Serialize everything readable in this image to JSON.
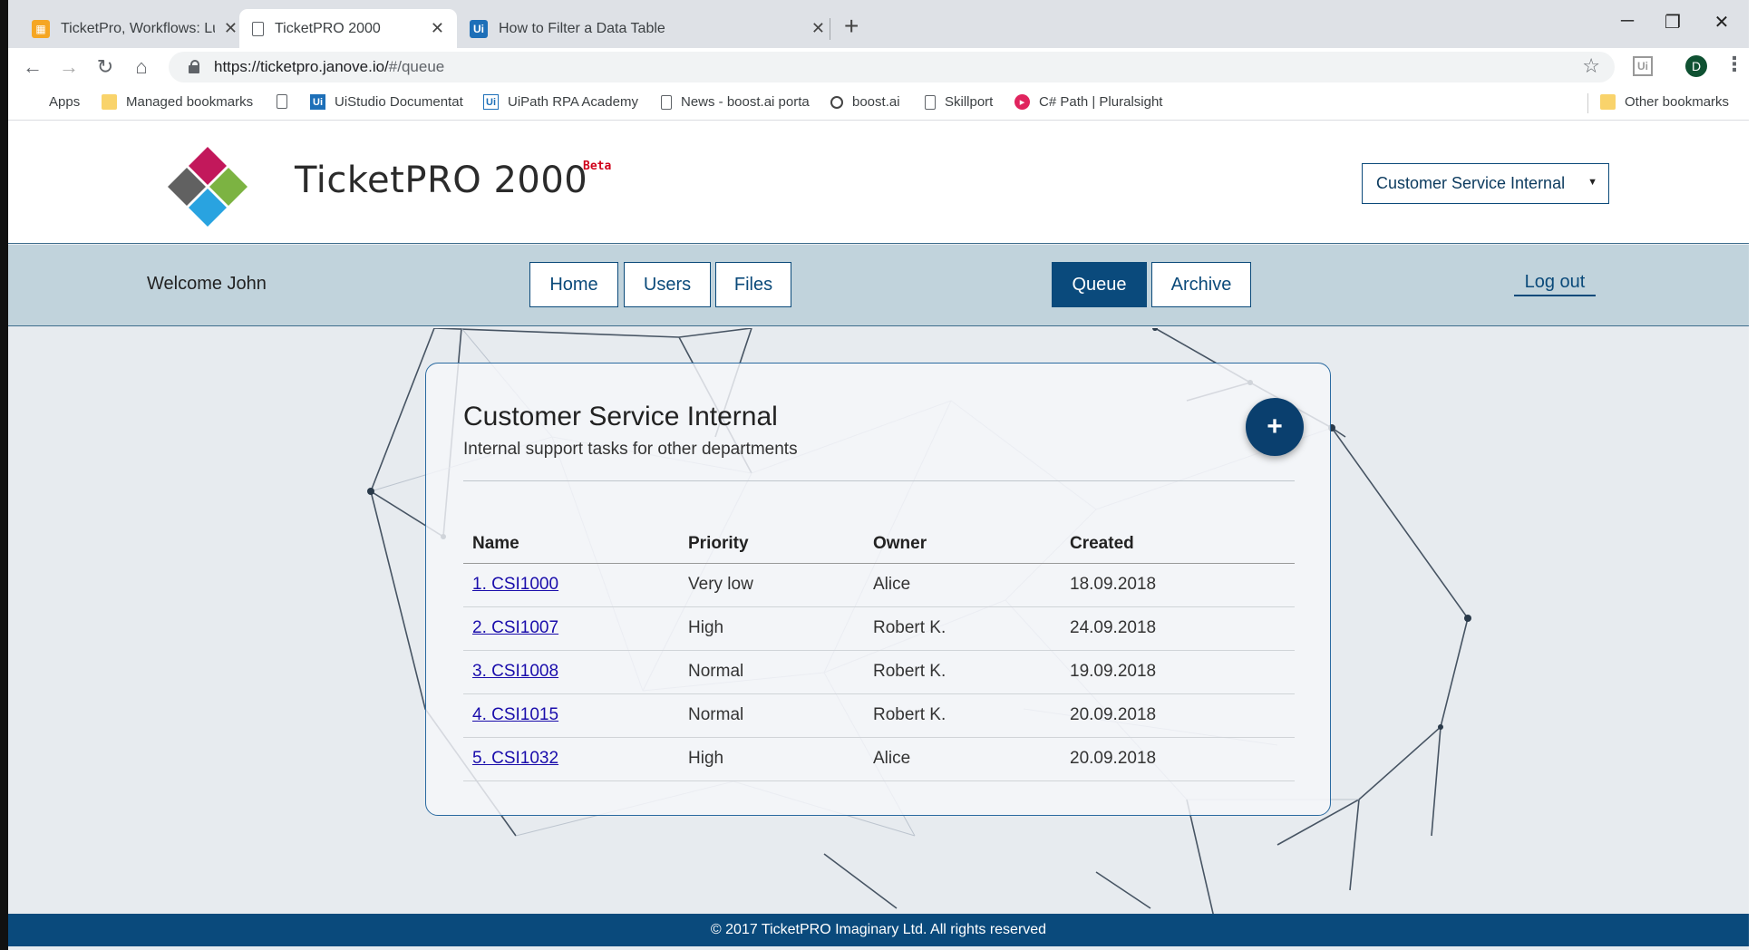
{
  "browser": {
    "tabs": [
      {
        "title": "TicketPro, Workflows: Lucidchart",
        "favicon": "lucidchart-icon",
        "color": "#f5a623"
      },
      {
        "title": "TicketPRO 2000",
        "favicon": "page-icon"
      },
      {
        "title": "How to Filter a Data Table",
        "favicon": "uipath-icon",
        "favicon_text": "Ui",
        "color": "#1d6fb8"
      }
    ],
    "url": {
      "host": "https://ticketpro.janove.io/",
      "path": "#/queue"
    },
    "profile_initial": "D",
    "extension_label": "Ui",
    "bookmarks": [
      {
        "label": "Apps",
        "icon": "apps-grid-icon"
      },
      {
        "label": "Managed bookmarks",
        "icon": "folder-icon"
      },
      {
        "label": "",
        "icon": "page-icon"
      },
      {
        "label": "UiStudio Documentat",
        "icon": "uipath-icon",
        "icon_text": "Ui"
      },
      {
        "label": "UiPath RPA Academy",
        "icon": "uipath-outline-icon",
        "icon_text": "Ui"
      },
      {
        "label": "News - boost.ai porta",
        "icon": "page-icon"
      },
      {
        "label": "boost.ai",
        "icon": "boost-icon"
      },
      {
        "label": "Skillport",
        "icon": "page-icon"
      },
      {
        "label": "C# Path | Pluralsight",
        "icon": "pluralsight-icon"
      },
      {
        "label": "Other bookmarks",
        "icon": "folder-icon"
      }
    ]
  },
  "header": {
    "brand": "TicketPRO 2000",
    "badge": "Beta",
    "department_select": "Customer Service Internal"
  },
  "nav": {
    "welcome": "Welcome John",
    "home": "Home",
    "users": "Users",
    "files": "Files",
    "queue": "Queue",
    "archive": "Archive",
    "logout": "Log out",
    "active": "Queue"
  },
  "queue": {
    "title": "Customer Service Internal",
    "subtitle": "Internal support tasks for other departments",
    "add_label": "+",
    "columns": [
      "Name",
      "Priority",
      "Owner",
      "Created"
    ],
    "rows": [
      {
        "name": "1. CSI1000",
        "priority": "Very low",
        "owner": "Alice",
        "created": "18.09.2018"
      },
      {
        "name": "2. CSI1007",
        "priority": "High",
        "owner": "Robert K.",
        "created": "24.09.2018"
      },
      {
        "name": "3. CSI1008",
        "priority": "Normal",
        "owner": "Robert K.",
        "created": "19.09.2018"
      },
      {
        "name": "4. CSI1015",
        "priority": "Normal",
        "owner": "Robert K.",
        "created": "20.09.2018"
      },
      {
        "name": "5. CSI1032",
        "priority": "High",
        "owner": "Alice",
        "created": "20.09.2018"
      }
    ]
  },
  "footer": {
    "text": "© 2017 TicketPRO Imaginary Ltd. All rights reserved"
  },
  "colors": {
    "primary": "#0a4a7c",
    "nav_bg": "#c1d3dc",
    "link": "#1a0dab",
    "beta": "#d0021b"
  }
}
